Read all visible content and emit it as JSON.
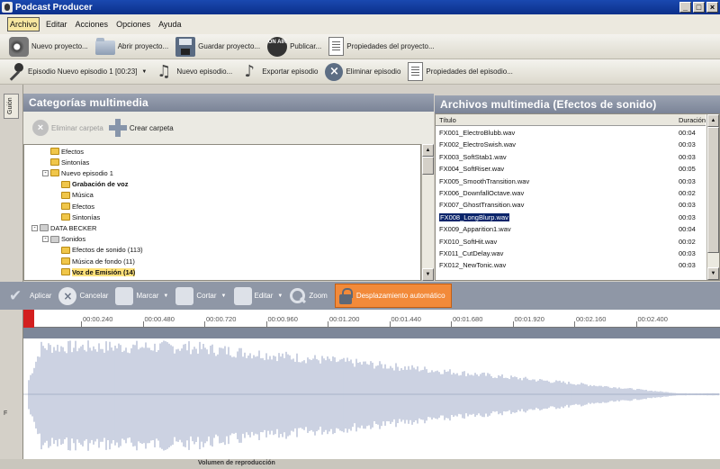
{
  "window": {
    "title": "Podcast Producer"
  },
  "menu": [
    "Archivo",
    "Editar",
    "Acciones",
    "Opciones",
    "Ayuda"
  ],
  "toolbar1": {
    "new_project": "Nuevo proyecto...",
    "open_project": "Abrir proyecto...",
    "save_project": "Guardar proyecto...",
    "publish": "Publicar...",
    "project_properties": "Propiedades del proyecto...",
    "onair_icon_text": "ON AIR"
  },
  "toolbar2": {
    "episode_selector": "Episodio Nuevo episodio 1 [00:23]",
    "new_episode": "Nuevo episodio...",
    "export_episode": "Exportar episodio",
    "delete_episode": "Eliminar episodio",
    "episode_properties": "Propiedades del episodio..."
  },
  "side_tab": "Guión",
  "categories": {
    "header": "Categorías multimedia",
    "delete_folder": "Eliminar carpeta",
    "create_folder": "Crear carpeta",
    "tree": [
      {
        "label": "Efectos",
        "indent": 1,
        "type": "folder"
      },
      {
        "label": "Sintonías",
        "indent": 1,
        "type": "folder"
      },
      {
        "label": "Nuevo episodio 1",
        "indent": 1,
        "type": "folder",
        "expander": "-"
      },
      {
        "label": "Grabación de voz",
        "indent": 2,
        "type": "folder",
        "bold": true
      },
      {
        "label": "Música",
        "indent": 2,
        "type": "folder"
      },
      {
        "label": "Efectos",
        "indent": 2,
        "type": "folder"
      },
      {
        "label": "Sintonías",
        "indent": 2,
        "type": "folder"
      },
      {
        "label": "DATA BECKER",
        "indent": 0,
        "type": "gray",
        "expander": "-"
      },
      {
        "label": "Sonidos",
        "indent": 1,
        "type": "gray",
        "expander": "-"
      },
      {
        "label": "Efectos de sonido (113)",
        "indent": 2,
        "type": "folder"
      },
      {
        "label": "Música de fondo (11)",
        "indent": 2,
        "type": "folder"
      },
      {
        "label": "Voz de Emisión (14)",
        "indent": 2,
        "type": "folder",
        "selected": true
      }
    ]
  },
  "files": {
    "header": "Archivos multimedia (Efectos de sonido)",
    "columns": {
      "title": "Título",
      "duration": "Duración"
    },
    "rows": [
      {
        "title": "FX001_ElectroBlubb.wav",
        "duration": "00:04"
      },
      {
        "title": "FX002_ElectroSwish.wav",
        "duration": "00:03"
      },
      {
        "title": "FX003_SoftStab1.wav",
        "duration": "00:03"
      },
      {
        "title": "FX004_SoftRiser.wav",
        "duration": "00:05"
      },
      {
        "title": "FX005_SmoothTransition.wav",
        "duration": "00:03"
      },
      {
        "title": "FX006_DownfallOctave.wav",
        "duration": "00:02"
      },
      {
        "title": "FX007_GhostTransition.wav",
        "duration": "00:03"
      },
      {
        "title": "FX008_LongBlurp.wav",
        "duration": "00:03",
        "selected": true
      },
      {
        "title": "FX009_Apparition1.wav",
        "duration": "00:04"
      },
      {
        "title": "FX010_SoftHit.wav",
        "duration": "00:02"
      },
      {
        "title": "FX011_CutDelay.wav",
        "duration": "00:03"
      },
      {
        "title": "FX012_NewTonic.wav",
        "duration": "00:03"
      }
    ]
  },
  "wave_toolbar": {
    "apply": "Aplicar",
    "cancel": "Cancelar",
    "mark": "Marcar",
    "cut": "Cortar",
    "edit": "Editar",
    "zoom": "Zoom",
    "autoscroll": "Desplazamiento automático"
  },
  "timeline": {
    "ticks": [
      "00:00.240",
      "00:00.480",
      "00:00.720",
      "00:00.960",
      "00:01.200",
      "00:01.440",
      "00:01.680",
      "00:01.920",
      "00:02.160",
      "00:02.400"
    ]
  },
  "wave_channel_label": "F",
  "status": {
    "volume_label": "Volumen de reproducción"
  },
  "colors": {
    "selection": "#0a246a",
    "autoscroll": "#f28a3a",
    "wave_fill": "#a9b4cf",
    "panel_header": "#8790a3"
  }
}
